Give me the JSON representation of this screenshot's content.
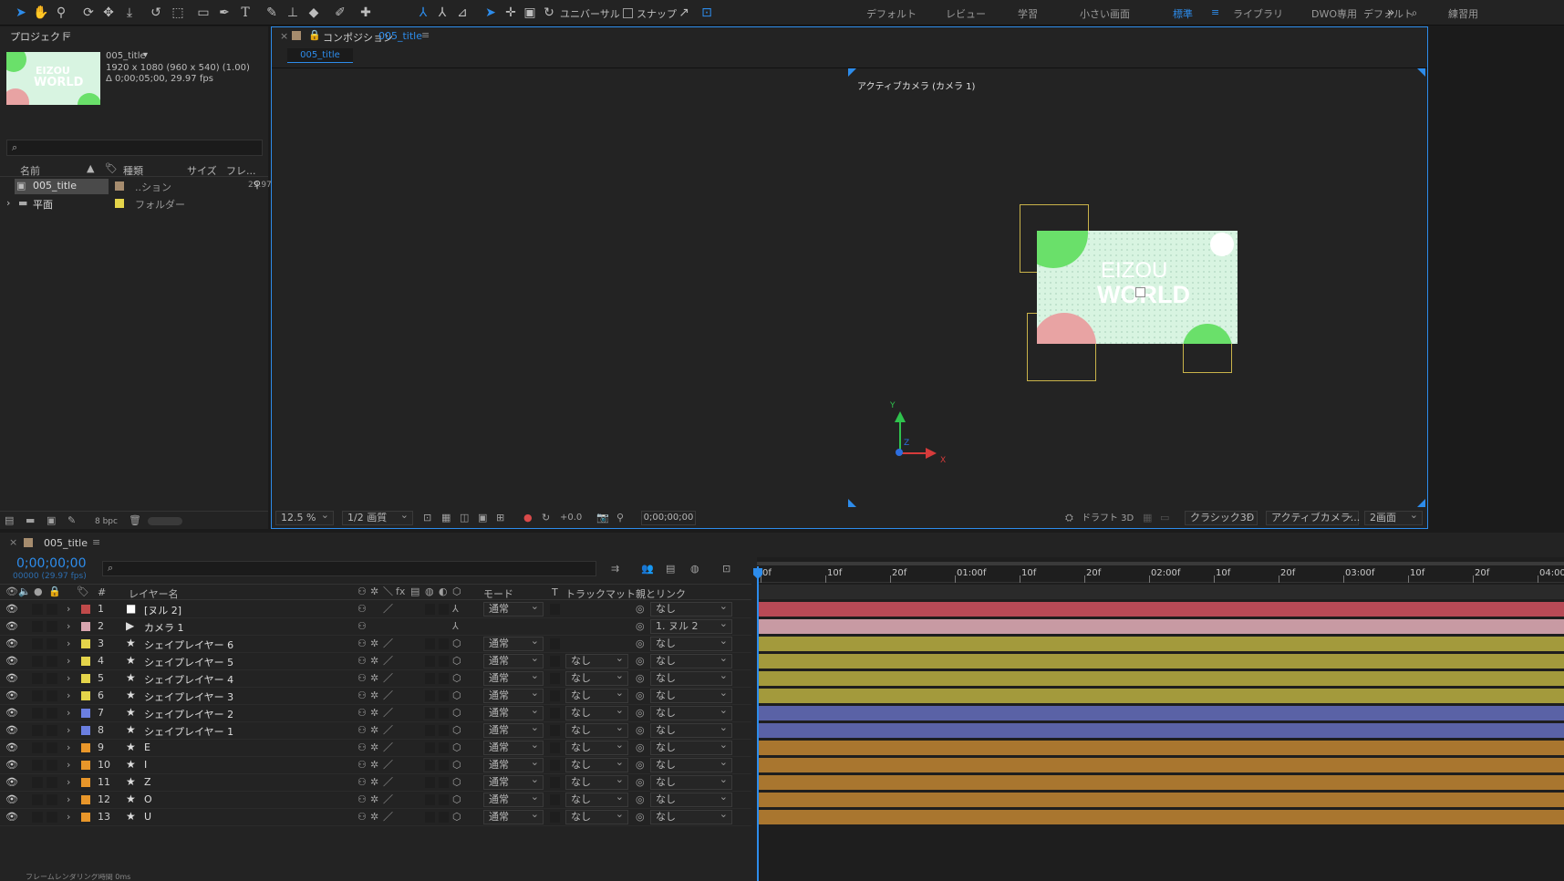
{
  "toolbar": {
    "universal": "ユニバーサル",
    "snap": "スナップ"
  },
  "workspaces": {
    "items": [
      "デフォルト",
      "レビュー",
      "学習",
      "小さい画面",
      "標準",
      "ライブラリ",
      "DWO専用",
      "デフォルト",
      "練習用"
    ],
    "active": "標準"
  },
  "project": {
    "title": "プロジェクト",
    "thumb_text_1": "EIZOU",
    "thumb_text_2": "WORLD",
    "item_name": "005_title",
    "item_size": "1920 x 1080 (960 x 540) (1.00)",
    "item_duration": "Δ 0;00;05;00, 29.97 fps",
    "search_placeholder": "",
    "columns": {
      "name": "名前",
      "type": "種類",
      "size": "サイズ",
      "frame": "フレ..."
    },
    "items": [
      {
        "name": "005_title",
        "type": "..ション",
        "fps": "29.97",
        "color": "#a68c6e"
      },
      {
        "name": "平面",
        "type": "フォルダー",
        "fps": "",
        "color": "#e4d44a"
      }
    ],
    "bpc": "8 bpc"
  },
  "comp": {
    "tab_prefix": "コンポジション",
    "tab_name": "005_title",
    "subtab": "005_title",
    "camera_label": "アクティブカメラ (カメラ 1)",
    "zoom": "12.5 %",
    "resolution": "1/2 画質",
    "exposure": "+0.0",
    "timecode": "0;00;00;00",
    "draft": "ドラフト 3D",
    "renderer": "クラシック3D",
    "view": "アクティブカメラ...",
    "layout": "2画面",
    "axes": {
      "x": "X",
      "y": "Y",
      "z": "Z"
    },
    "frame_text_1": "EIZOU",
    "frame_text_2": "WORLD"
  },
  "timeline": {
    "tab": "005_title",
    "timecode": "0;00;00;00",
    "fps_line": "00000 (29.97 fps)",
    "search_placeholder": "",
    "columns": {
      "num": "#",
      "name": "レイヤー名",
      "mode": "モード",
      "t": "T",
      "trackmatte": "トラックマット",
      "parent": "親とリンク"
    },
    "ruler": [
      "0f",
      "10f",
      "20f",
      "01:00f",
      "10f",
      "20f",
      "02:00f",
      "10f",
      "20f",
      "03:00f",
      "10f",
      "20f",
      "04:00f"
    ],
    "layers": [
      {
        "num": "1",
        "name": "[ヌル 2]",
        "kind": "null",
        "label": "#c04a4a",
        "mode": "通常",
        "matte": "",
        "parent": "なし",
        "bar": "#b84a56"
      },
      {
        "num": "2",
        "name": "カメラ 1",
        "kind": "camera",
        "label": "#d9a6b0",
        "mode": "",
        "matte": "",
        "parent": "1. ヌル 2",
        "bar": "#c89aa3"
      },
      {
        "num": "3",
        "name": "シェイプレイヤー 6",
        "kind": "shape",
        "label": "#e4d44a",
        "mode": "通常",
        "matte": "",
        "parent": "なし",
        "bar": "#a39a3c"
      },
      {
        "num": "4",
        "name": "シェイプレイヤー 5",
        "kind": "shape",
        "label": "#e4d44a",
        "mode": "通常",
        "matte": "なし",
        "parent": "なし",
        "bar": "#a39a3c"
      },
      {
        "num": "5",
        "name": "シェイプレイヤー 4",
        "kind": "shape",
        "label": "#e4d44a",
        "mode": "通常",
        "matte": "なし",
        "parent": "なし",
        "bar": "#a39a3c"
      },
      {
        "num": "6",
        "name": "シェイプレイヤー 3",
        "kind": "shape",
        "label": "#e4d44a",
        "mode": "通常",
        "matte": "なし",
        "parent": "なし",
        "bar": "#a39a3c"
      },
      {
        "num": "7",
        "name": "シェイプレイヤー 2",
        "kind": "shape",
        "label": "#6b7fe0",
        "mode": "通常",
        "matte": "なし",
        "parent": "なし",
        "bar": "#5a62a6"
      },
      {
        "num": "8",
        "name": "シェイプレイヤー 1",
        "kind": "shape",
        "label": "#6b7fe0",
        "mode": "通常",
        "matte": "なし",
        "parent": "なし",
        "bar": "#5a62a6"
      },
      {
        "num": "9",
        "name": "E",
        "kind": "text",
        "label": "#e8962a",
        "mode": "通常",
        "matte": "なし",
        "parent": "なし",
        "bar": "#a9762f"
      },
      {
        "num": "10",
        "name": "I",
        "kind": "text",
        "label": "#e8962a",
        "mode": "通常",
        "matte": "なし",
        "parent": "なし",
        "bar": "#a9762f"
      },
      {
        "num": "11",
        "name": "Z",
        "kind": "text",
        "label": "#e8962a",
        "mode": "通常",
        "matte": "なし",
        "parent": "なし",
        "bar": "#a9762f"
      },
      {
        "num": "12",
        "name": "O",
        "kind": "text",
        "label": "#e8962a",
        "mode": "通常",
        "matte": "なし",
        "parent": "なし",
        "bar": "#a9762f"
      },
      {
        "num": "13",
        "name": "U",
        "kind": "text",
        "label": "#e8962a",
        "mode": "通常",
        "matte": "なし",
        "parent": "なし",
        "bar": "#a9762f"
      }
    ],
    "footer": "フレームレンダリング時間 0ms"
  },
  "colors": {
    "accent": "#2d8ceb",
    "panel": "#232323",
    "bg": "#1b1b1b"
  }
}
